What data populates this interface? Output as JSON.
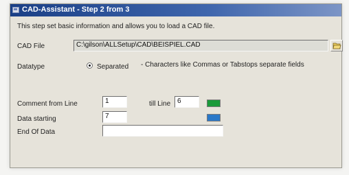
{
  "window": {
    "title": "CAD-Assistant - Step 2 from 3",
    "description": "This step set basic information and allows you to load a CAD file."
  },
  "cad_file": {
    "label": "CAD File",
    "value": "C:\\gilson\\ALLSetup\\CAD\\BEISPIEL.CAD"
  },
  "datatype": {
    "label": "Datatype",
    "option_label": "Separated",
    "hint": "- Characters like Commas or Tabstops separate fields"
  },
  "lines": {
    "comment_label": "Comment from Line",
    "comment_value": "1",
    "till_label": "till Line",
    "till_value": "6",
    "data_starting_label": "Data starting",
    "data_starting_value": "7",
    "end_label": "End Of Data",
    "end_value": ""
  },
  "colors": {
    "comment_swatch": "#1a9a3a",
    "data_swatch": "#2a78c8"
  },
  "icons": {
    "browse": "folder-open-icon",
    "window": "app-window-icon"
  }
}
